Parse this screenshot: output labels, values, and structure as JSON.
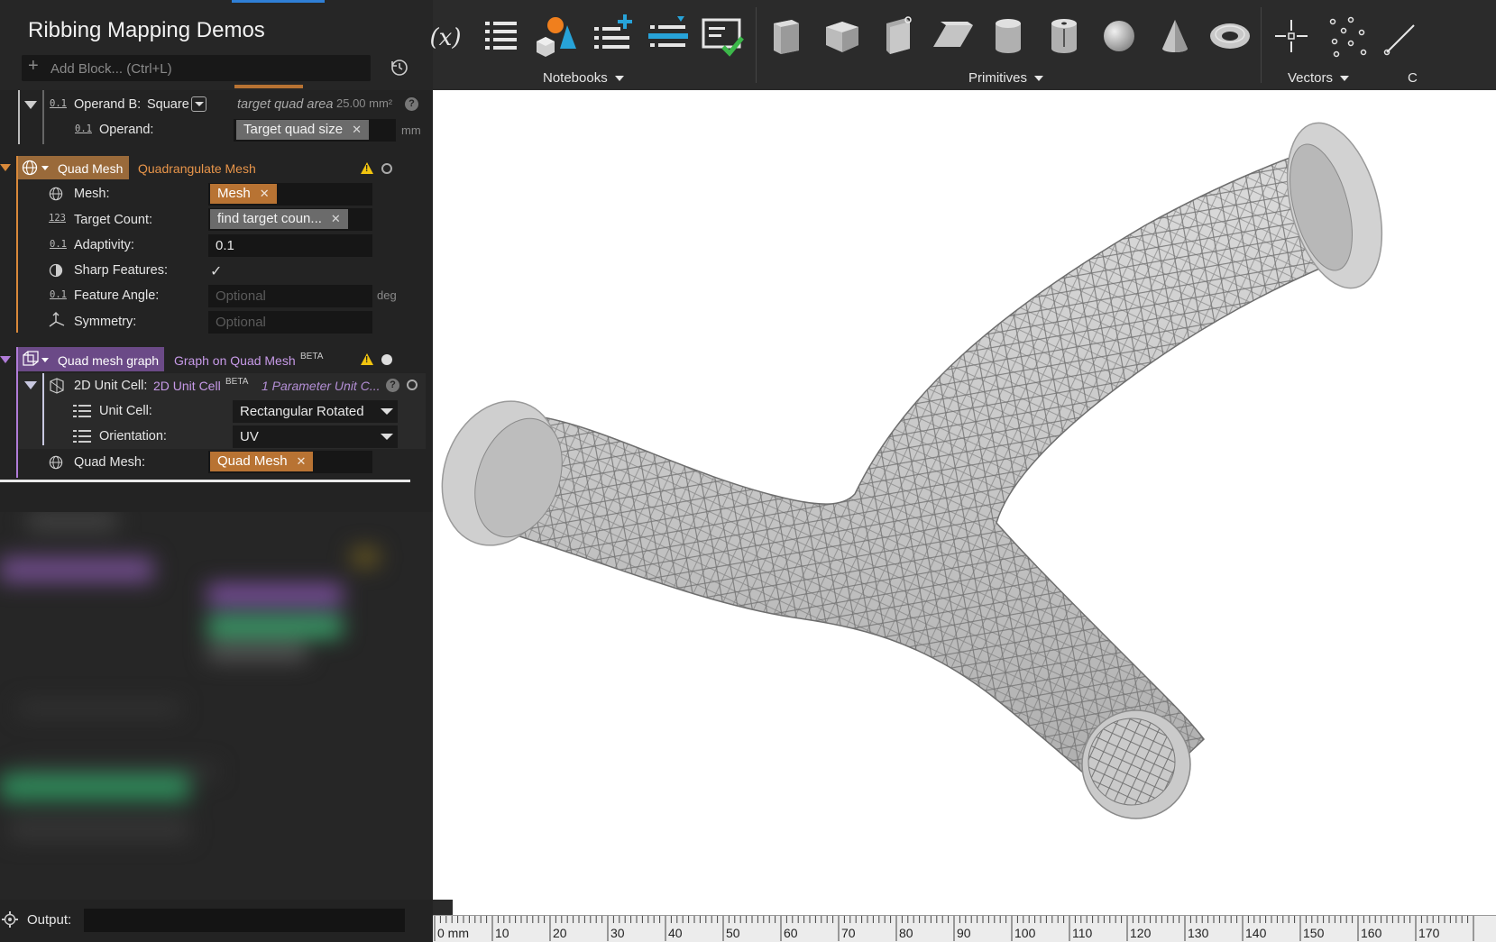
{
  "app": {
    "title": "Ribbing Mapping Demos"
  },
  "add_block": {
    "placeholder": "Add Block... (Ctrl+L)"
  },
  "icons": {
    "add": "plus-icon",
    "history": "history-icon",
    "collapse": "triangle-down-icon",
    "mesh": "globe-icon",
    "count": "number-123-icon",
    "decimal": "decimal-01-icon",
    "sharp": "half-circle-icon",
    "symmetry": "axes-icon",
    "list": "list-icon",
    "warning": "warning-icon",
    "help": "question-icon",
    "status": "status-circle-icon",
    "settings": "gear-icon",
    "cell": "unit-cell-icon",
    "graph": "graph-icon"
  },
  "colors": {
    "accent_blue": "#2f7fd6",
    "quad_mesh_orange": "#d9893a",
    "graph_purple": "#b07cd8",
    "warning_yellow": "#f1c40f"
  },
  "operand_b": {
    "type_label": "Operand B:",
    "type_value": "Square",
    "hint": "target quad area",
    "hint_value": "25.00 mm²",
    "operand_label": "Operand:",
    "operand_chip": "Target quad size",
    "operand_unit": "mm"
  },
  "quad_mesh_block": {
    "name": "Quad Mesh",
    "function": "Quadrangulate Mesh",
    "params": {
      "mesh": {
        "label": "Mesh:",
        "chip": "Mesh"
      },
      "target_count": {
        "label": "Target Count:",
        "chip": "find target coun..."
      },
      "adaptivity": {
        "label": "Adaptivity:",
        "value": "0.1"
      },
      "sharp_features": {
        "label": "Sharp Features:",
        "value": "✓"
      },
      "feature_angle": {
        "label": "Feature Angle:",
        "placeholder": "Optional",
        "unit": "deg"
      },
      "symmetry": {
        "label": "Symmetry:",
        "placeholder": "Optional"
      }
    }
  },
  "graph_block": {
    "name": "Quad mesh graph",
    "function": "Graph on Quad Mesh",
    "badge": "BETA",
    "unit_cell": {
      "label": "2D Unit Cell:",
      "function": "2D Unit Cell",
      "badge": "BETA",
      "hint": "1 Parameter Unit C...",
      "unit_cell_label": "Unit Cell:",
      "unit_cell_value": "Rectangular Rotated",
      "orientation_label": "Orientation:",
      "orientation_value": "UV"
    },
    "quad_mesh_label": "Quad Mesh:",
    "quad_mesh_chip": "Quad Mesh"
  },
  "output": {
    "label": "Output:",
    "value": ""
  },
  "toolbar": {
    "groups": [
      {
        "label": "Notebooks"
      },
      {
        "label": "Primitives"
      },
      {
        "label": "Vectors"
      },
      {
        "label": "C"
      }
    ],
    "buttons": [
      "variable-icon",
      "list-icon",
      "shapes-icon",
      "add-list-icon",
      "insert-list-icon",
      "checklist-icon",
      "cube-icon",
      "box-icon",
      "prism-icon",
      "parallelepiped-icon",
      "cylinder-icon",
      "tube-icon",
      "sphere-icon",
      "cone-icon",
      "torus-icon",
      "point-icon",
      "point-cloud-icon",
      "line-icon"
    ]
  },
  "ruler": {
    "unit_label": "0 mm",
    "labels": [
      "10",
      "20",
      "30",
      "40",
      "50",
      "60",
      "70",
      "80",
      "90",
      "100",
      "110",
      "120",
      "130",
      "140",
      "150",
      "160",
      "170"
    ]
  }
}
